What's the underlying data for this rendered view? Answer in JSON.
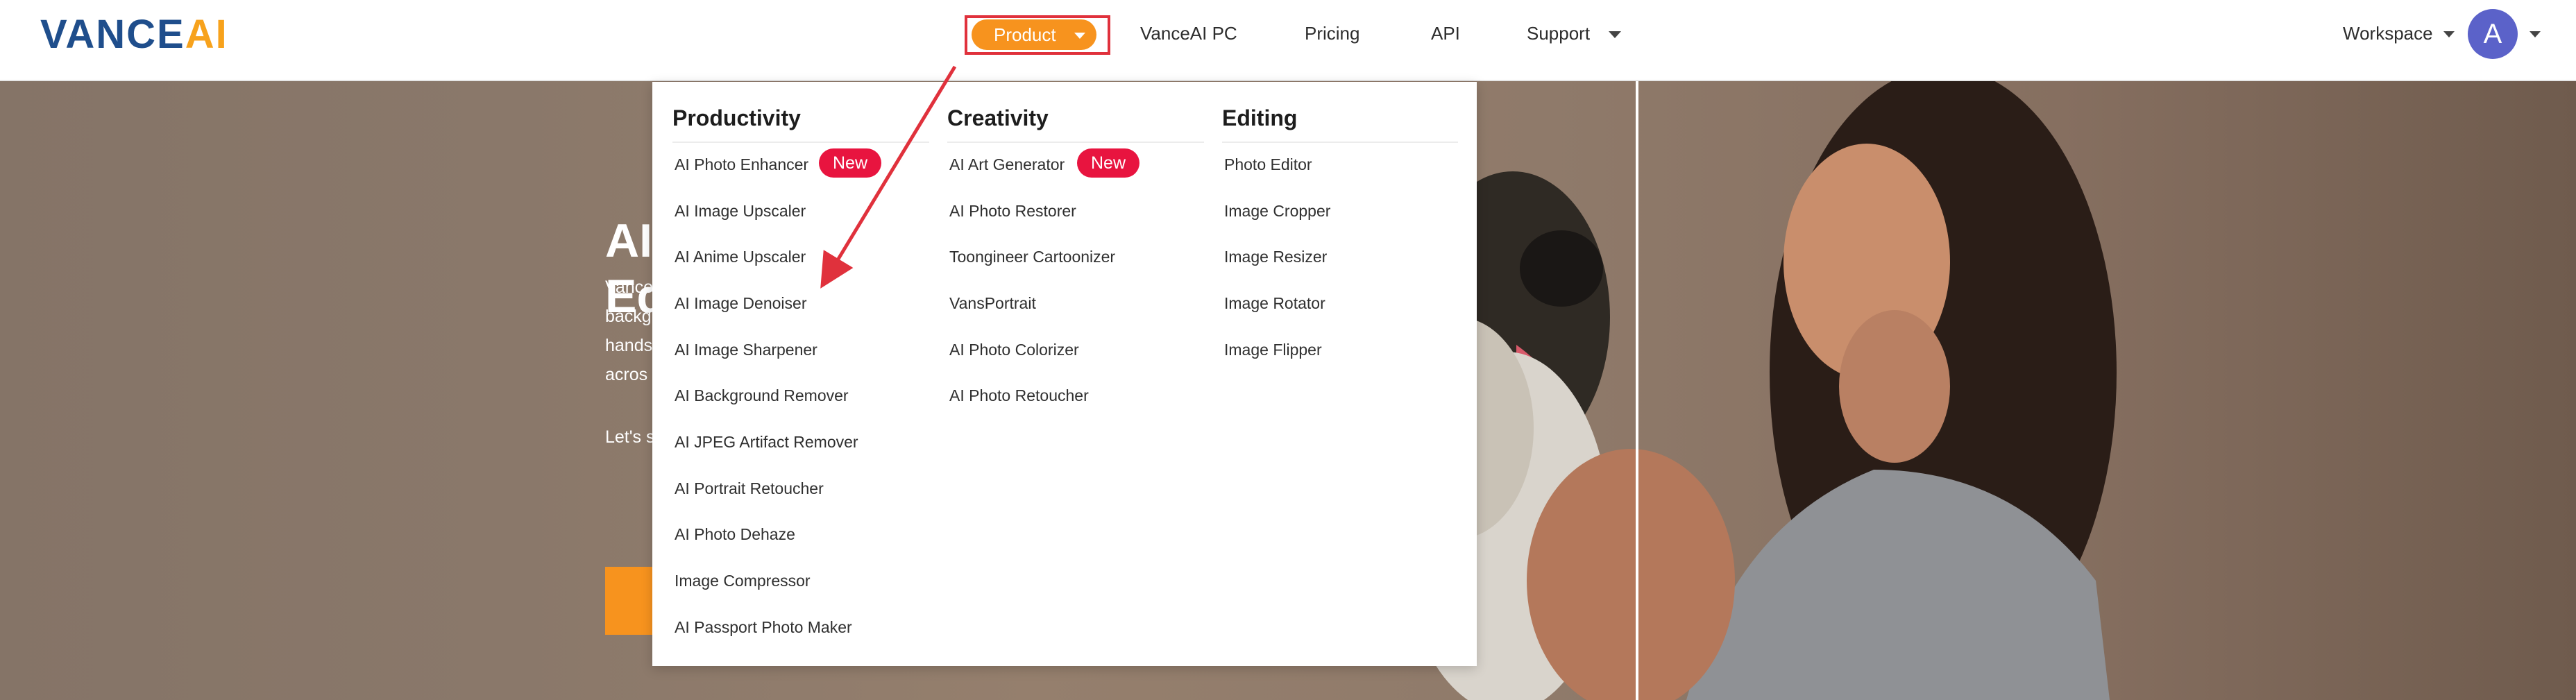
{
  "header": {
    "logo": {
      "part1": "VANCE",
      "part2": "AI"
    },
    "nav": {
      "product": "Product",
      "vanceai_pc": "VanceAI PC",
      "pricing": "Pricing",
      "api": "API",
      "support": "Support"
    },
    "workspace": "Workspace",
    "avatar_letter": "A"
  },
  "hero": {
    "title_line1": "AI",
    "title_line2": "Ed",
    "lines": [
      "Vance",
      "backg",
      "hands",
      "acros"
    ],
    "cta_prefix": "Let's s"
  },
  "dropdown": {
    "productivity": {
      "heading": "Productivity",
      "items": [
        "AI Photo Enhancer",
        "AI Image Upscaler",
        "AI Anime Upscaler",
        "AI Image Denoiser",
        "AI Image Sharpener",
        "AI Background Remover",
        "AI JPEG Artifact Remover",
        "AI Portrait Retoucher",
        "AI Photo Dehaze",
        "Image Compressor",
        "AI Passport Photo Maker"
      ],
      "badge": "New"
    },
    "creativity": {
      "heading": "Creativity",
      "items": [
        "AI Art Generator",
        "AI Photo Restorer",
        "Toongineer Cartoonizer",
        "VansPortrait",
        "AI Photo Colorizer",
        "AI Photo Retoucher"
      ],
      "badge": "New"
    },
    "editing": {
      "heading": "Editing",
      "items": [
        "Photo Editor",
        "Image Cropper",
        "Image Resizer",
        "Image Rotator",
        "Image Flipper"
      ]
    }
  },
  "colors": {
    "accent_orange": "#f7931e",
    "brand_blue": "#1f4e8c",
    "badge_red": "#e8143f",
    "annotation_red": "#e0313c"
  }
}
